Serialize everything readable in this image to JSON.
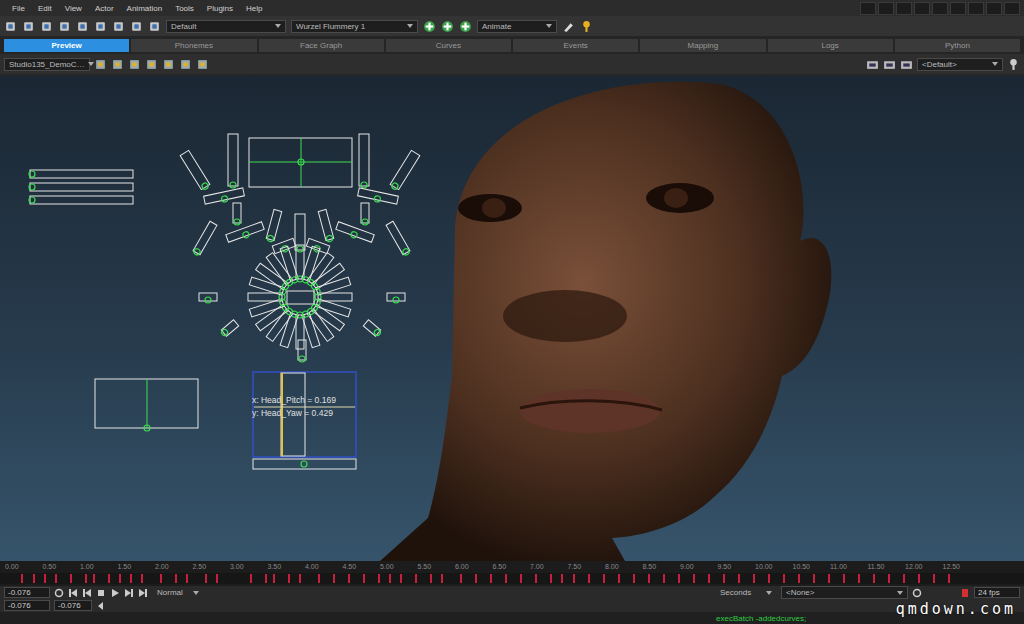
{
  "menu": [
    "File",
    "Edit",
    "View",
    "Actor",
    "Animation",
    "Tools",
    "Plugins",
    "Help"
  ],
  "toolbar": {
    "layout": "Default",
    "actor": "Wurzel Flummery 1",
    "mode": "Animate"
  },
  "tabs": [
    {
      "label": "Preview",
      "selected": true
    },
    {
      "label": "Phonemes",
      "selected": false
    },
    {
      "label": "Face Graph",
      "selected": false
    },
    {
      "label": "Curves",
      "selected": false
    },
    {
      "label": "Events",
      "selected": false
    },
    {
      "label": "Mapping",
      "selected": false
    },
    {
      "label": "Logs",
      "selected": false
    },
    {
      "label": "Python",
      "selected": false
    }
  ],
  "viewport_bar": {
    "camera": "Studio135_DemoC…",
    "view": "<Default>"
  },
  "tooltip": {
    "x": "x: Head_Pitch = 0.169",
    "y": "y: Head_Yaw = 0.429"
  },
  "timeline": {
    "ticks": [
      "0.00",
      "0.50",
      "1.00",
      "1.50",
      "2.00",
      "2.50",
      "3.00",
      "3.50",
      "4.00",
      "4.50",
      "5.00",
      "5.50",
      "6.00",
      "6.50",
      "7.00",
      "7.50",
      "8.00",
      "8.50",
      "9.00",
      "9.50",
      "10.00",
      "10.50",
      "11.00",
      "11.50",
      "12.00",
      "12.50"
    ],
    "keys": [
      0.15,
      0.3,
      0.45,
      0.6,
      0.8,
      1.0,
      1.1,
      1.3,
      1.45,
      1.6,
      1.75,
      2.0,
      2.2,
      2.35,
      2.6,
      2.75,
      3.2,
      3.4,
      3.5,
      3.7,
      3.85,
      4.1,
      4.3,
      4.5,
      4.7,
      4.9,
      5.05,
      5.2,
      5.4,
      5.6,
      5.75,
      6.0,
      6.2,
      6.4,
      6.6,
      6.8,
      7.0,
      7.2,
      7.35,
      7.5,
      7.7,
      7.9,
      8.1,
      8.3,
      8.5,
      8.7,
      8.9,
      9.1,
      9.3,
      9.5,
      9.7,
      9.9,
      10.1,
      10.3,
      10.5,
      10.7,
      10.9,
      11.1,
      11.3,
      11.5,
      11.7,
      11.9,
      12.1,
      12.3,
      12.5
    ]
  },
  "transport": {
    "time": "-0.076",
    "range_start": "-0.076",
    "range_end": "-0.076",
    "speed": "Normal",
    "units": "Seconds",
    "animation": "<None>",
    "fps": "24 fps"
  },
  "console": "execBatch -addedcurves;",
  "watermark": "qmdown.com"
}
